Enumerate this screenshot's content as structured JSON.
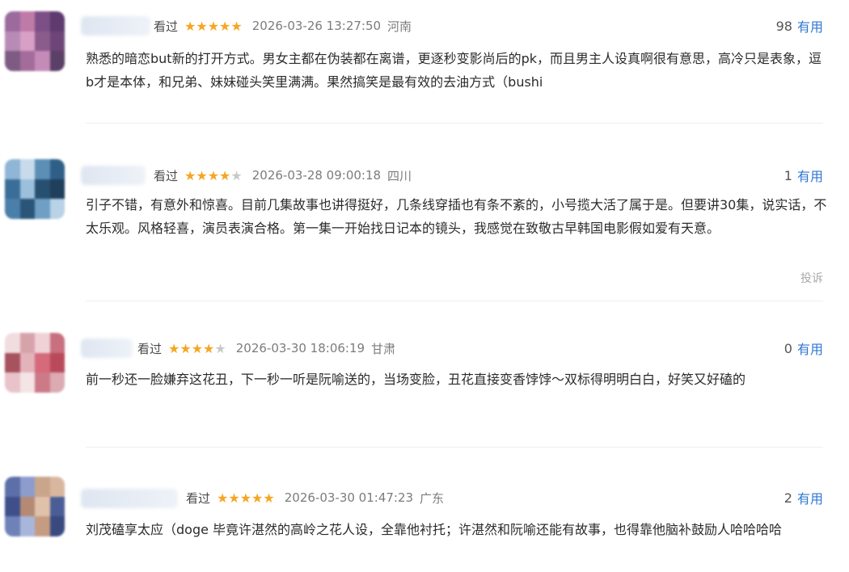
{
  "reviews": [
    {
      "watched_label": "看过",
      "stars": 5,
      "timestamp": "2026-03-26 13:27:50",
      "location": "河南",
      "useful_count": "98",
      "useful_label": "有用",
      "content": "熟悉的暗恋but新的打开方式。男女主都在伪装都在离谱，更逐秒变影尚后的pk，而且男主人设真啊很有意思，高冷只是表象，逗b才是本体，和兄弟、妹妹碰头笑里满满。果然搞笑是最有效的去油方式（bushi",
      "avatar_colors": [
        "#9c6b9e",
        "#c07aa8",
        "#7c4f86",
        "#5e3a6e",
        "#b78bb5",
        "#d9a0c6",
        "#8a5c8c",
        "#6e4577",
        "#7d5b82",
        "#a36c9b",
        "#c48bb8",
        "#5a3f66"
      ]
    },
    {
      "watched_label": "看过",
      "stars": 4,
      "timestamp": "2026-03-28 09:00:18",
      "location": "四川",
      "useful_count": "1",
      "useful_label": "有用",
      "content": "引子不错，有意外和惊喜。目前几集故事也讲得挺好，几条线穿插也有条不紊的，小号揽大活了属于是。但要讲30集，说实话，不太乐观。风格轻喜，演员表演合格。第一集一开始找日记本的镜头，我感觉在致敬古早韩国电影假如爱有天意。",
      "report_label": "投诉",
      "avatar_colors": [
        "#8fb6d6",
        "#c7dbea",
        "#5c8fb6",
        "#2f5f86",
        "#3a6e98",
        "#9cc0dc",
        "#274f70",
        "#1f3f5c",
        "#4a7fa9",
        "#2a5578",
        "#6f9fc5",
        "#b8d2e6"
      ]
    },
    {
      "watched_label": "看过",
      "stars": 4,
      "timestamp": "2026-03-30 18:06:19",
      "location": "甘肃",
      "useful_count": "0",
      "useful_label": "有用",
      "content": "前一秒还一脸嫌弃这花丑，下一秒一听是阮喻送的，当场变脸，丑花直接变香饽饽～双标得明明白白，好笑又好磕的",
      "avatar_colors": [
        "#f1dde0",
        "#d7a3ab",
        "#efd2d6",
        "#c96f7d",
        "#a7525f",
        "#e3b3bb",
        "#d46a7a",
        "#b94a5b",
        "#e8c4ca",
        "#f4e4e6",
        "#cc7a88",
        "#dcaab2"
      ]
    },
    {
      "watched_label": "看过",
      "stars": 5,
      "timestamp": "2026-03-30 01:47:23",
      "location": "广东",
      "useful_count": "2",
      "useful_label": "有用",
      "content": "刘茂磕享太应（doge 毕竟许湛然的高岭之花人设，全靠他衬托；许湛然和阮喻还能有故事，也得靠他脑补鼓励人哈哈哈哈",
      "avatar_colors": [
        "#5d6fa8",
        "#8c9ccc",
        "#c9a58c",
        "#d9b79f",
        "#3e4f8a",
        "#b48a74",
        "#e0c2ab",
        "#4a5d96",
        "#6f82b8",
        "#a9b6dc",
        "#c59c82",
        "#394a80"
      ]
    }
  ]
}
